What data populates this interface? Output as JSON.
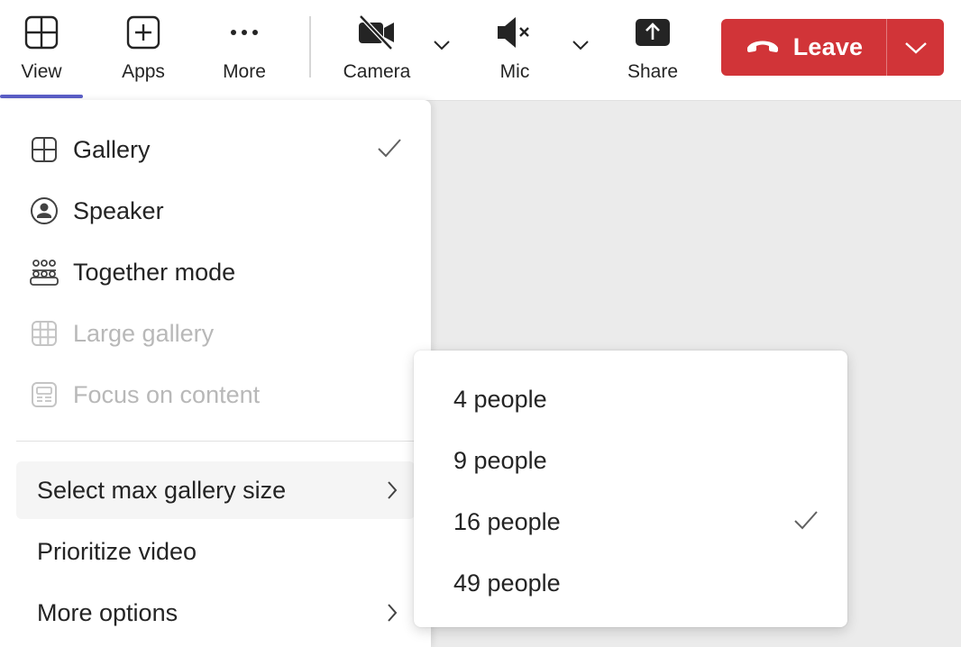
{
  "toolbar": {
    "view_label": "View",
    "apps_label": "Apps",
    "more_label": "More",
    "camera_label": "Camera",
    "mic_label": "Mic",
    "share_label": "Share",
    "leave_label": "Leave"
  },
  "view_menu": {
    "items": [
      {
        "label": "Gallery",
        "icon": "grid-icon",
        "checked": true,
        "disabled": false
      },
      {
        "label": "Speaker",
        "icon": "speaker-person-icon",
        "checked": false,
        "disabled": false
      },
      {
        "label": "Together mode",
        "icon": "people-audience-icon",
        "checked": false,
        "disabled": false
      },
      {
        "label": "Large gallery",
        "icon": "large-grid-icon",
        "checked": false,
        "disabled": true
      },
      {
        "label": "Focus on content",
        "icon": "content-view-icon",
        "checked": false,
        "disabled": true
      }
    ],
    "options": [
      {
        "label": "Select max gallery size",
        "has_submenu": true,
        "active": true
      },
      {
        "label": "Prioritize video",
        "has_submenu": false,
        "active": false
      },
      {
        "label": "More options",
        "has_submenu": true,
        "active": false
      }
    ]
  },
  "gallery_size_submenu": {
    "items": [
      {
        "label": "4 people",
        "checked": false
      },
      {
        "label": "9 people",
        "checked": false
      },
      {
        "label": "16 people",
        "checked": true
      },
      {
        "label": "49 people",
        "checked": false
      }
    ]
  },
  "colors": {
    "accent": "#5b5fc7",
    "leave_red": "#d13438",
    "text": "#242424",
    "disabled_text": "#b8b8b8",
    "stage_background": "#ebebeb"
  }
}
